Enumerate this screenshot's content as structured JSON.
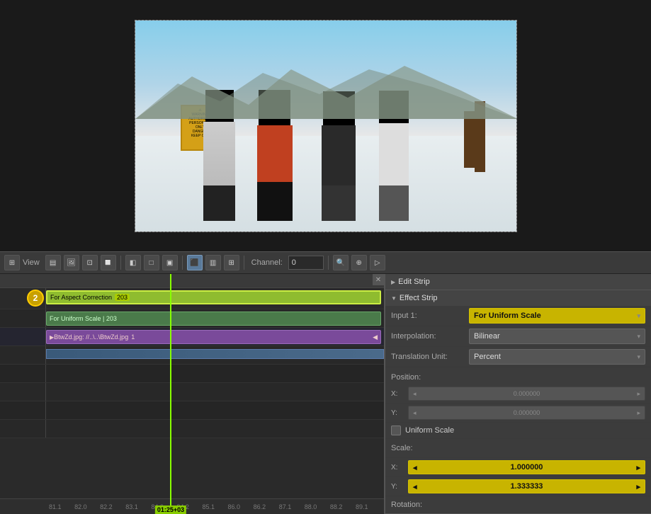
{
  "preview": {
    "close_icon": "✕"
  },
  "toolbar": {
    "view_label": "View",
    "channel_label": "Channel:",
    "channel_value": "0"
  },
  "timeline": {
    "header_close": "✕",
    "strips": [
      {
        "id": "strip1",
        "label": "For Aspect Correction",
        "number": "203",
        "type": "green-selected",
        "channel": 3
      },
      {
        "id": "strip2",
        "label": "For Uniform Scale | 203",
        "type": "green",
        "channel": 2
      },
      {
        "id": "strip3",
        "label": "BtwZd.jpg: //...\\BtwZd.jpg",
        "number": "1",
        "type": "purple",
        "channel": 1
      }
    ],
    "channel_bubble": "2",
    "playhead_time": "01:25+03",
    "footer_numbers": [
      "81.1",
      "82.0",
      "82.2",
      "83.1",
      "84.0",
      "84.2",
      "85.1",
      "86.0",
      "86.2",
      "87.1",
      "88.0",
      "88.2",
      "89.1"
    ]
  },
  "properties": {
    "edit_strip_label": "Edit Strip",
    "edit_strip_icon": "▶",
    "effect_strip_label": "Effect Strip",
    "effect_strip_icon": "▼",
    "input1_label": "Input 1:",
    "input1_value": "For Uniform Scale",
    "interpolation_label": "Interpolation:",
    "interpolation_value": "Bilinear",
    "translation_unit_label": "Translation Unit:",
    "translation_unit_value": "Percent",
    "position_label": "Position:",
    "pos_x_label": "X:",
    "pos_x_value": "0.000000",
    "pos_y_label": "Y:",
    "pos_y_value": "0.000000",
    "uniform_scale_label": "Uniform Scale",
    "scale_label": "Scale:",
    "scale_x_label": "X:",
    "scale_x_value": "1.000000",
    "scale_y_label": "Y:",
    "scale_y_value": "1.333333",
    "rotation_label": "Rotation:",
    "dropdown_arrow": "▾",
    "left_arrow": "◂",
    "right_arrow": "▸"
  }
}
